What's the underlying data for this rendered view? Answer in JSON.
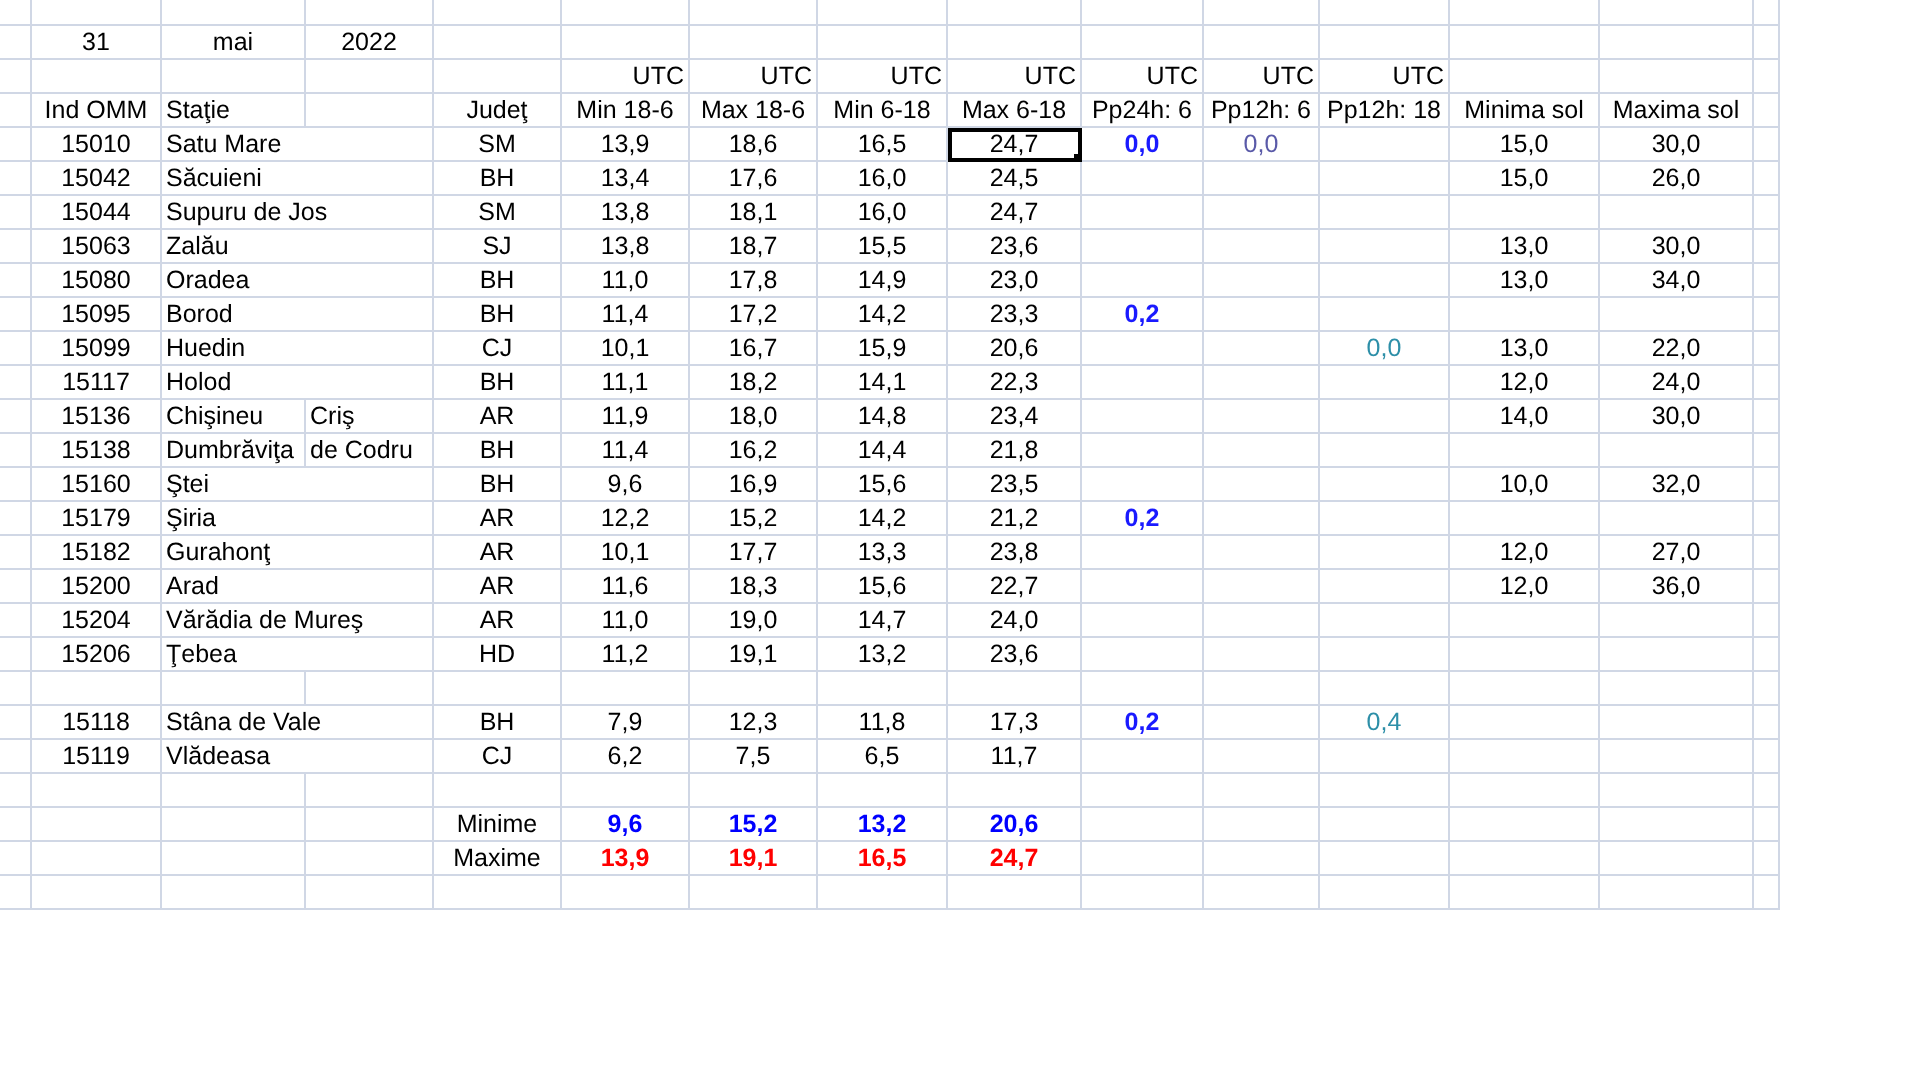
{
  "date": {
    "day": "31",
    "month": "mai",
    "year": "2022"
  },
  "columns": [
    {
      "label": "Ind OMM"
    },
    {
      "label": "Staţie"
    },
    {
      "label": "Judeţ"
    },
    {
      "label": "Min 18-6",
      "unit": "UTC"
    },
    {
      "label": "Max 18-6",
      "unit": "UTC"
    },
    {
      "label": "Min 6-18",
      "unit": "UTC"
    },
    {
      "label": "Max 6-18",
      "unit": "UTC"
    },
    {
      "label": "Pp24h: 6",
      "unit": "UTC"
    },
    {
      "label": "Pp12h: 6",
      "unit": "UTC"
    },
    {
      "label": "Pp12h: 18",
      "unit": "UTC"
    },
    {
      "label": "Minima sol"
    },
    {
      "label": "Maxima sol"
    }
  ],
  "station_groups": [
    {
      "rows": [
        {
          "ind": "15010",
          "station": "Satu Mare",
          "county": "SM",
          "min_18_6": "13,9",
          "max_18_6": "18,6",
          "min_6_18": "16,5",
          "max_6_18": "24,7",
          "pp24": "0,0",
          "pp12_6": "0,0",
          "soil_min": "15,0",
          "soil_max": "30,0",
          "selected": true
        },
        {
          "ind": "15042",
          "station": "Săcuieni",
          "county": "BH",
          "min_18_6": "13,4",
          "max_18_6": "17,6",
          "min_6_18": "16,0",
          "max_6_18": "24,5",
          "soil_min": "15,0",
          "soil_max": "26,0",
          "selected": false
        },
        {
          "ind": "15044",
          "station": "Supuru de Jos",
          "county": "SM",
          "min_18_6": "13,8",
          "max_18_6": "18,1",
          "min_6_18": "16,0",
          "max_6_18": "24,7",
          "selected": false
        },
        {
          "ind": "15063",
          "station": "Zalău",
          "county": "SJ",
          "min_18_6": "13,8",
          "max_18_6": "18,7",
          "min_6_18": "15,5",
          "max_6_18": "23,6",
          "soil_min": "13,0",
          "soil_max": "30,0",
          "selected": false
        },
        {
          "ind": "15080",
          "station": "Oradea",
          "county": "BH",
          "min_18_6": "11,0",
          "max_18_6": "17,8",
          "min_6_18": "14,9",
          "max_6_18": "23,0",
          "soil_min": "13,0",
          "soil_max": "34,0",
          "selected": false
        },
        {
          "ind": "15095",
          "station": "Borod",
          "county": "BH",
          "min_18_6": "11,4",
          "max_18_6": "17,2",
          "min_6_18": "14,2",
          "max_6_18": "23,3",
          "pp24": "0,2",
          "selected": false
        },
        {
          "ind": "15099",
          "station": "Huedin",
          "county": "CJ",
          "min_18_6": "10,1",
          "max_18_6": "16,7",
          "min_6_18": "15,9",
          "max_6_18": "20,6",
          "pp12_18": "0,0",
          "soil_min": "13,0",
          "soil_max": "22,0",
          "selected": false
        },
        {
          "ind": "15117",
          "station": "Holod",
          "county": "BH",
          "min_18_6": "11,1",
          "max_18_6": "18,2",
          "min_6_18": "14,1",
          "max_6_18": "22,3",
          "soil_min": "12,0",
          "soil_max": "24,0",
          "selected": false
        },
        {
          "ind": "15136",
          "station": "Chişineu",
          "station_2": "Criş",
          "county": "AR",
          "min_18_6": "11,9",
          "max_18_6": "18,0",
          "min_6_18": "14,8",
          "max_6_18": "23,4",
          "soil_min": "14,0",
          "soil_max": "30,0",
          "selected": false
        },
        {
          "ind": "15138",
          "station": "Dumbrăviţa",
          "station_2": "de Codru",
          "county": "BH",
          "min_18_6": "11,4",
          "max_18_6": "16,2",
          "min_6_18": "14,4",
          "max_6_18": "21,8",
          "selected": false
        },
        {
          "ind": "15160",
          "station": "Ştei",
          "county": "BH",
          "min_18_6": "9,6",
          "max_18_6": "16,9",
          "min_6_18": "15,6",
          "max_6_18": "23,5",
          "soil_min": "10,0",
          "soil_max": "32,0",
          "selected": false
        },
        {
          "ind": "15179",
          "station": "Şiria",
          "county": "AR",
          "min_18_6": "12,2",
          "max_18_6": "15,2",
          "min_6_18": "14,2",
          "max_6_18": "21,2",
          "pp24": "0,2",
          "selected": false
        },
        {
          "ind": "15182",
          "station": "Gurahonţ",
          "county": "AR",
          "min_18_6": "10,1",
          "max_18_6": "17,7",
          "min_6_18": "13,3",
          "max_6_18": "23,8",
          "soil_min": "12,0",
          "soil_max": "27,0",
          "selected": false
        },
        {
          "ind": "15200",
          "station": "Arad",
          "county": "AR",
          "min_18_6": "11,6",
          "max_18_6": "18,3",
          "min_6_18": "15,6",
          "max_6_18": "22,7",
          "soil_min": "12,0",
          "soil_max": "36,0",
          "selected": false
        },
        {
          "ind": "15204",
          "station": "Vărădia de Mureş",
          "county": "AR",
          "min_18_6": "11,0",
          "max_18_6": "19,0",
          "min_6_18": "14,7",
          "max_6_18": "24,0",
          "selected": false
        },
        {
          "ind": "15206",
          "station": "Ţebea",
          "county": "HD",
          "min_18_6": "11,2",
          "max_18_6": "19,1",
          "min_6_18": "13,2",
          "max_6_18": "23,6",
          "selected": false
        }
      ]
    },
    {
      "rows": [
        {
          "ind": "15118",
          "station": "Stâna de Vale",
          "county": "BH",
          "min_18_6": "7,9",
          "max_18_6": "12,3",
          "min_6_18": "11,8",
          "max_6_18": "17,3",
          "pp24": "0,2",
          "pp12_18": "0,4",
          "selected": false
        },
        {
          "ind": "15119",
          "station": "Vlădeasa",
          "county": "CJ",
          "min_18_6": "6,2",
          "max_18_6": "7,5",
          "min_6_18": "6,5",
          "max_6_18": "11,7",
          "selected": false
        }
      ]
    }
  ],
  "summary": [
    {
      "kind": "min",
      "label": "Minime",
      "values": [
        "9,6",
        "15,2",
        "13,2",
        "20,6"
      ]
    },
    {
      "kind": "max",
      "label": "Maxime",
      "values": [
        "13,9",
        "19,1",
        "16,5",
        "24,7"
      ]
    }
  ]
}
